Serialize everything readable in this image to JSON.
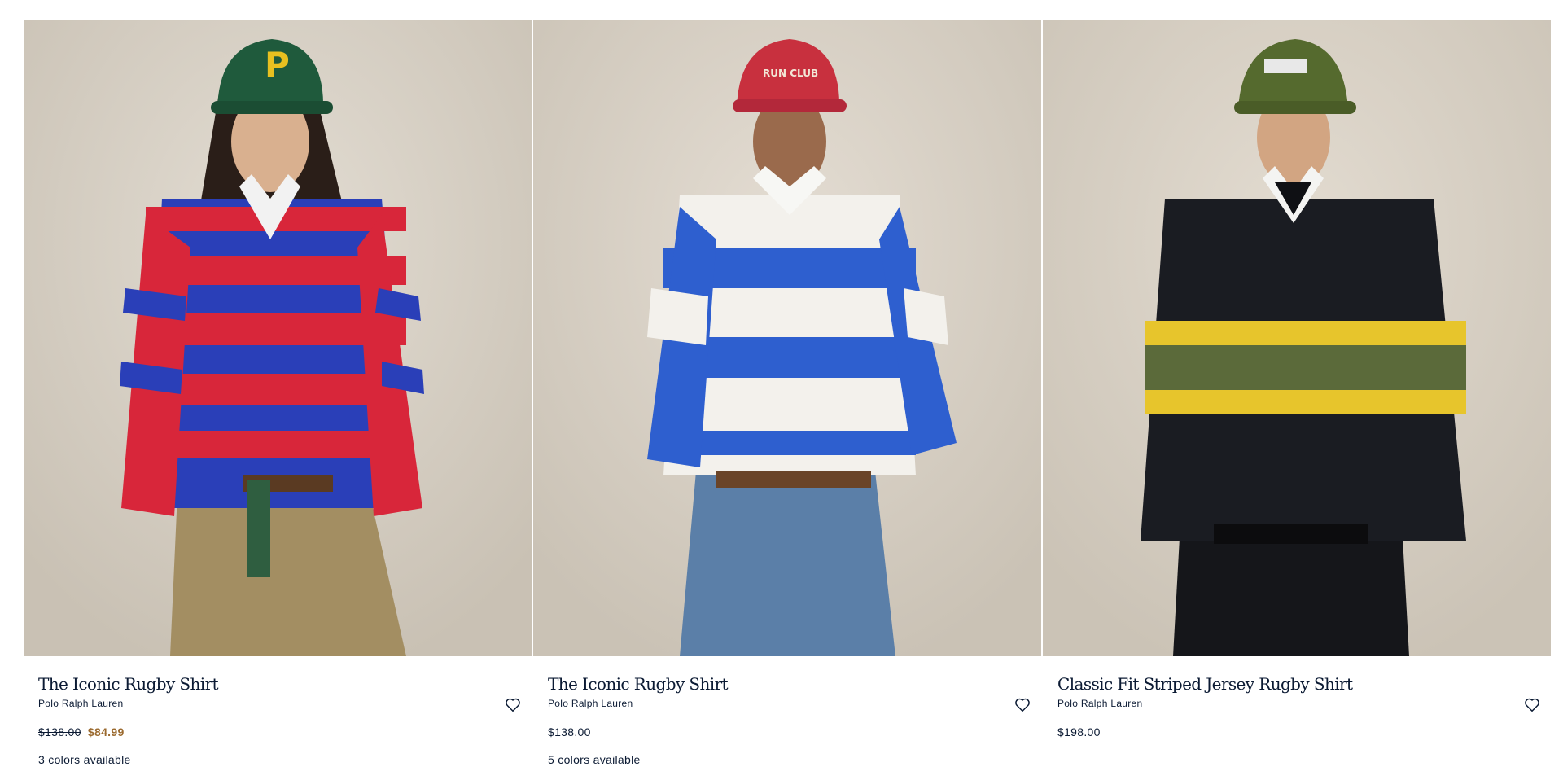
{
  "products": [
    {
      "title": "The Iconic Rugby Shirt",
      "brand": "Polo Ralph Lauren",
      "price_original": "$138.00",
      "price_sale": "$84.99",
      "price": "",
      "colors": "3 colors available",
      "palette": {
        "bg": "#d6cfc4",
        "stripe_a": "#d8263a",
        "stripe_b": "#2a3fb8",
        "hat": "#1f5a3c",
        "hat_logo": "#e8c020",
        "pants": "#a38e62"
      },
      "icon": "heart-outline-icon"
    },
    {
      "title": "The Iconic Rugby Shirt",
      "brand": "Polo Ralph Lauren",
      "price_original": "",
      "price_sale": "",
      "price": "$138.00",
      "colors": "5 colors available",
      "palette": {
        "bg": "#d8d1c6",
        "stripe_a": "#f3f1ec",
        "stripe_b": "#2e5fcf",
        "hat": "#c8303e",
        "hat_logo": "#f2e6d6",
        "pants": "#5b7fa8"
      },
      "icon": "heart-outline-icon"
    },
    {
      "title": "Classic Fit Striped Jersey Rugby Shirt",
      "brand": "Polo Ralph Lauren",
      "price_original": "",
      "price_sale": "",
      "price": "$198.00",
      "colors": "",
      "palette": {
        "bg": "#d9d2c7",
        "stripe_a": "#1a1c22",
        "stripe_b": "#e7c52c",
        "stripe_c": "#5b6a3a",
        "hat": "#556a2e",
        "hat_logo": "#e8e8e8",
        "pants": "#15161a"
      },
      "icon": "heart-outline-icon"
    }
  ]
}
